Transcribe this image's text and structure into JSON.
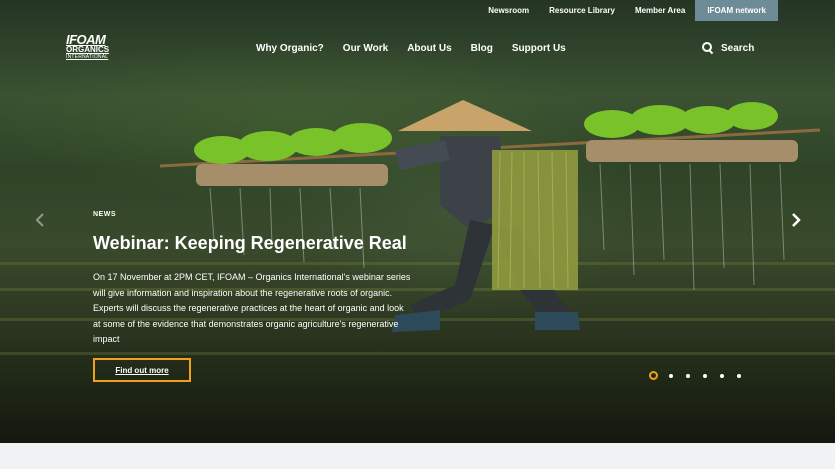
{
  "utility_nav": [
    "Newsroom",
    "Resource Library",
    "Member Area",
    "IFOAM network"
  ],
  "logo": {
    "line1": "IFOAM",
    "line2": "ORGANICS",
    "line3": "INTERNATIONAL"
  },
  "main_nav": [
    "Why Organic?",
    "Our Work",
    "About Us",
    "Blog",
    "Support Us"
  ],
  "search": {
    "label": "Search"
  },
  "hero": {
    "tag": "NEWS",
    "title": "Webinar: Keeping Regenerative Real",
    "description": "On 17 November at 2PM CET, IFOAM – Organics International's webinar series will give information and inspiration about the regenerative roots of organic. Experts will discuss the regenerative practices at the heart of organic and look at some of the evidence that demonstrates organic agriculture's regenerative impact",
    "cta": "Find out more"
  },
  "carousel": {
    "slides": 6,
    "active": 1
  },
  "colors": {
    "accent": "#f0a11a",
    "network_tab": "#6d8c97"
  }
}
